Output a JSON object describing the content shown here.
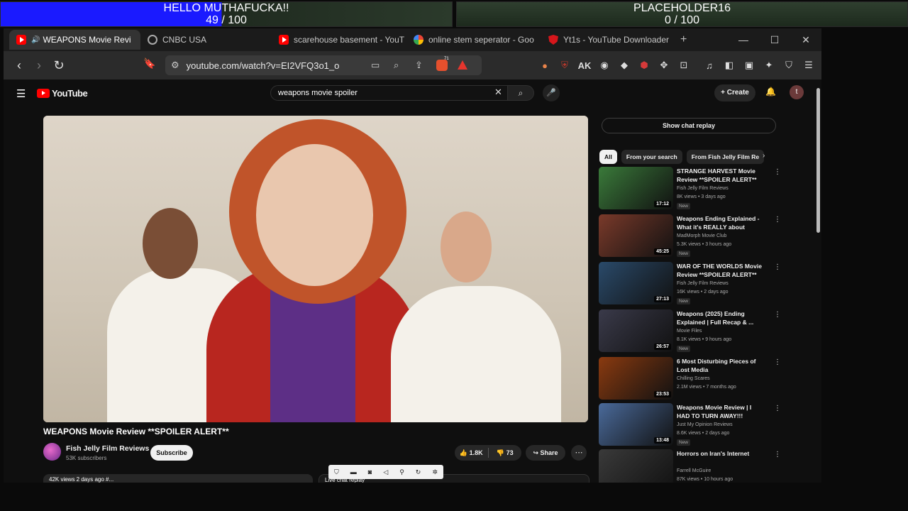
{
  "overlay": {
    "left": {
      "title": "HELLO MUTHAFUCKA!!",
      "progress_text": "49 / 100",
      "progress": 0.49
    },
    "right": {
      "title": "PLACEHOLDER16",
      "progress_text": "0 / 100",
      "progress": 0
    }
  },
  "tabs": [
    {
      "label": "WEAPONS Movie Revi",
      "icon": "youtube-icon",
      "active": true
    },
    {
      "label": "CNBC USA",
      "icon": "globe-icon"
    },
    {
      "label": "scarehouse basement - YouT",
      "icon": "youtube-icon"
    },
    {
      "label": "online stem seperator - Goo",
      "icon": "google-icon"
    },
    {
      "label": "Yt1s - YouTube Downloader",
      "icon": "shield-icon"
    }
  ],
  "url": "youtube.com/watch?v=EI2VFQ3o1_o",
  "brave_badge": "71",
  "youtube": {
    "logo": "YouTube",
    "search_value": "weapons movie spoiler",
    "create_label": "Create",
    "avatar_letter": "t"
  },
  "video": {
    "title": "WEAPONS Movie Review **SPOILER ALERT**",
    "channel": "Fish Jelly Film Reviews",
    "subscribers": "53K subscribers",
    "subscribe_label": "Subscribe",
    "likes": "1.8K",
    "dislikes": "73",
    "share_label": "Share",
    "description_peek": "42K views  2 days ago  #...",
    "chat_peek": "Live chat replay"
  },
  "sidebar": {
    "chat_replay_label": "Show chat replay",
    "chips": [
      "All",
      "From your search",
      "From Fish Jelly Film Re"
    ],
    "recommendations": [
      {
        "title": "STRANGE HARVEST Movie Review **SPOILER ALERT**",
        "channel": "Fish Jelly Film Reviews",
        "meta": "8K views • 3 days ago",
        "badge": "New",
        "duration": "17:12",
        "thumb_color": "#3a7a3a"
      },
      {
        "title": "Weapons Ending Explained - What it's REALLY about",
        "channel": "MadMorph Movie Club",
        "meta": "5.3K views • 3 hours ago",
        "badge": "New",
        "duration": "45:25",
        "thumb_color": "#7a3a2a"
      },
      {
        "title": "WAR OF THE WORLDS Movie Review **SPOILER ALERT**",
        "channel": "Fish Jelly Film Reviews",
        "meta": "16K views • 2 days ago",
        "badge": "New",
        "duration": "27:13",
        "thumb_color": "#2a4a6a"
      },
      {
        "title": "Weapons (2025) Ending Explained | Full Recap & ...",
        "channel": "Movie Files",
        "meta": "8.1K views • 9 hours ago",
        "badge": "New",
        "duration": "26:57",
        "thumb_color": "#3a3a4a"
      },
      {
        "title": "6 Most Disturbing Pieces of Lost Media",
        "channel": "Chilling Scares",
        "meta": "2.1M views • 7 months ago",
        "badge": "",
        "duration": "23:53",
        "thumb_color": "#8a3a10"
      },
      {
        "title": "Weapons Movie Review | I HAD TO TURN AWAY!!!",
        "channel": "Just My Opinion Reviews",
        "meta": "8.6K views • 2 days ago",
        "badge": "New",
        "duration": "13:48",
        "thumb_color": "#4a6a9a"
      },
      {
        "title": "Horrors on Iran's Internet",
        "channel": "Farrell McGuire",
        "meta": "87K views • 10 hours ago",
        "badge": "",
        "duration": "",
        "thumb_color": "#3a3a3a"
      }
    ]
  }
}
